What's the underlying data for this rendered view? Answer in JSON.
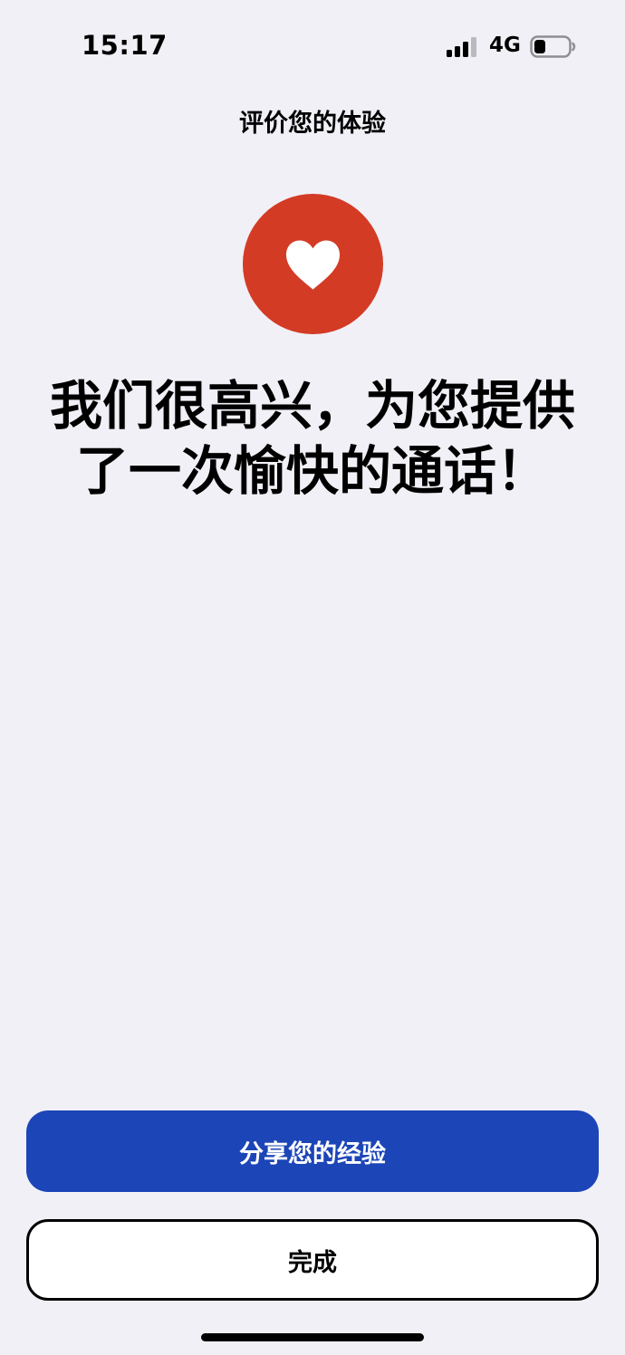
{
  "status_bar": {
    "time": "15:17",
    "network": "4G",
    "icons": [
      "signal-icon",
      "battery-icon"
    ]
  },
  "header": {
    "title": "评价您的体验"
  },
  "hero": {
    "icon": "heart-icon",
    "icon_color": "#d33b25",
    "headline": "我们很高兴，为您提供了一次愉快的通话！"
  },
  "actions": {
    "share_label": "分享您的经验",
    "share_color": "#1c45b7",
    "done_label": "完成"
  },
  "colors": {
    "background": "#f1f0f6"
  }
}
